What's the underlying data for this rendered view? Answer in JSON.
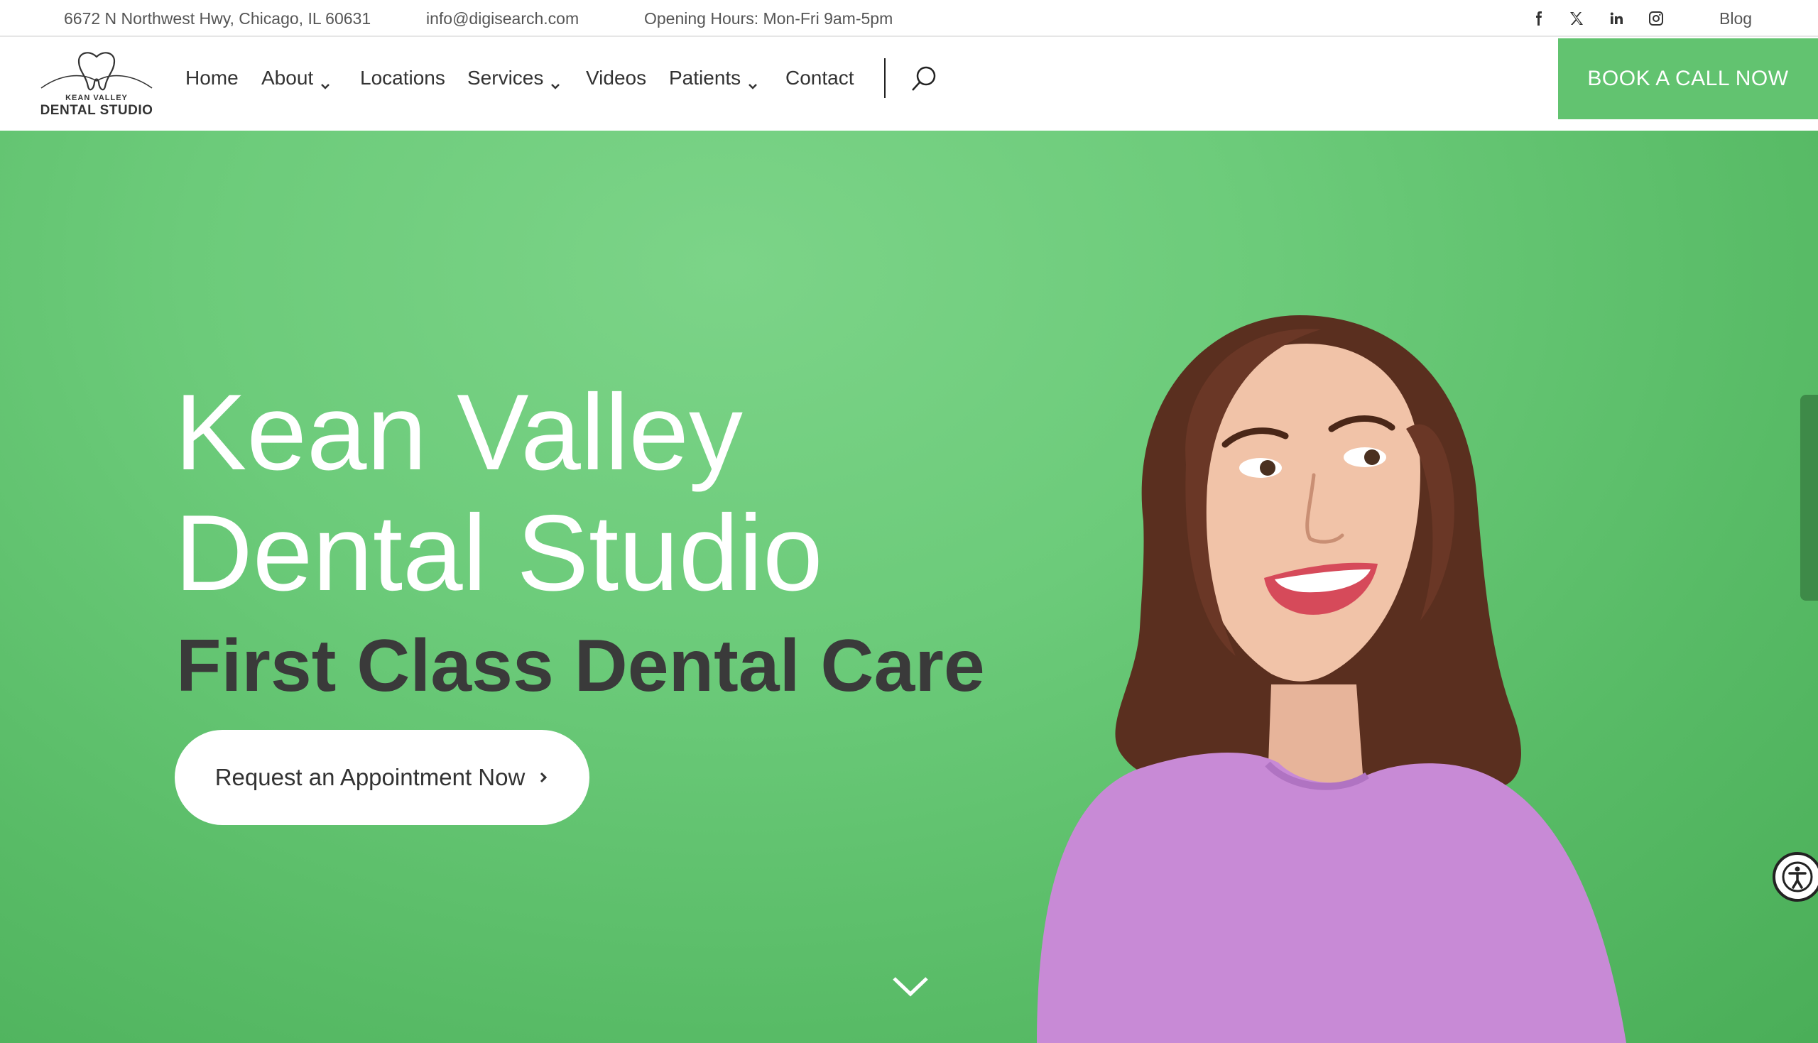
{
  "topbar": {
    "address": "6672 N Northwest Hwy, Chicago, IL 60631",
    "email": "info@digisearch.com",
    "hours": "Opening Hours: Mon-Fri 9am-5pm",
    "social_icons": [
      "facebook-icon",
      "x-twitter-icon",
      "linkedin-icon",
      "instagram-icon"
    ],
    "blog_label": "Blog"
  },
  "logo": {
    "line1": "KEAN VALLEY",
    "line2": "DENTAL STUDIO"
  },
  "nav": {
    "items": [
      {
        "label": "Home",
        "dropdown": false
      },
      {
        "label": "About",
        "dropdown": true
      },
      {
        "label": "Locations",
        "dropdown": false
      },
      {
        "label": "Services",
        "dropdown": true
      },
      {
        "label": "Videos",
        "dropdown": false
      },
      {
        "label": "Patients",
        "dropdown": true
      },
      {
        "label": "Contact",
        "dropdown": false
      }
    ],
    "cta_label": "BOOK A CALL NOW"
  },
  "hero": {
    "title_line1": "Kean Valley",
    "title_line2": "Dental Studio",
    "subtitle": "First Class Dental Care",
    "button_label": "Request an Appointment Now"
  },
  "colors": {
    "brand_green": "#62c370",
    "hero_green": "#5fbf6c",
    "subtitle_dark": "#3a3a3a",
    "shirt_purple": "#c88ad6"
  }
}
